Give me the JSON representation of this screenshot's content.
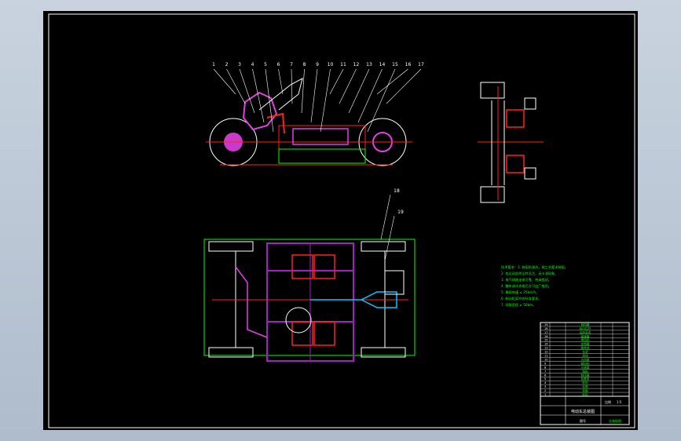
{
  "drawing": {
    "background": "#000000",
    "frame_color": "#ffffff",
    "palette": {
      "white": "#ffffff",
      "red": "#ff2020",
      "magenta": "#e040e0",
      "purple": "#a020c0",
      "green": "#00ff00",
      "yellow": "#ffff00",
      "cyan": "#00c8ff"
    }
  },
  "side_view": {
    "part_numbers": [
      "1",
      "2",
      "3",
      "4",
      "5",
      "6",
      "7",
      "8",
      "9",
      "10",
      "11",
      "12",
      "13",
      "14",
      "15",
      "16",
      "17"
    ]
  },
  "top_view": {
    "part_numbers": [
      "18",
      "19"
    ]
  },
  "notes": {
    "lines": [
      "技术要求：1. 装配前清洗，按工艺要求装配。",
      "2. 各运动部件运转灵活，无卡滞现象。",
      "3. 电气线路连接可靠，绝缘良好。",
      "4. 整车调试合格后方可出厂使用。",
      "5. 最高车速 ≤ 25km/h。",
      "6. 制动距离符合标准要求。",
      "7. 续驶里程 ≥ 50km。"
    ]
  },
  "title_block": {
    "drawing_title": "电动车总装图",
    "scale_label": "比例",
    "scale_value": "1:5",
    "sheet_label": "图号",
    "company": "总装配图"
  },
  "parts_list": {
    "rows": [
      {
        "no": "19",
        "name": "转向器"
      },
      {
        "no": "18",
        "name": "转向拉杆"
      },
      {
        "no": "17",
        "name": "后桥总成"
      },
      {
        "no": "16",
        "name": "差速器"
      },
      {
        "no": "15",
        "name": "电动机"
      },
      {
        "no": "14",
        "name": "控制器"
      },
      {
        "no": "13",
        "name": "蓄电池"
      },
      {
        "no": "12",
        "name": "车架"
      },
      {
        "no": "11",
        "name": "座椅"
      },
      {
        "no": "10",
        "name": "方向盘"
      },
      {
        "no": "9",
        "name": "转向柱"
      },
      {
        "no": "8",
        "name": "仪表盘"
      },
      {
        "no": "7",
        "name": "踏板"
      },
      {
        "no": "6",
        "name": "制动器"
      },
      {
        "no": "5",
        "name": "前悬架"
      },
      {
        "no": "4",
        "name": "前桥"
      },
      {
        "no": "3",
        "name": "轮毂"
      },
      {
        "no": "2",
        "name": "轮胎"
      },
      {
        "no": "1",
        "name": "前轮"
      }
    ]
  }
}
